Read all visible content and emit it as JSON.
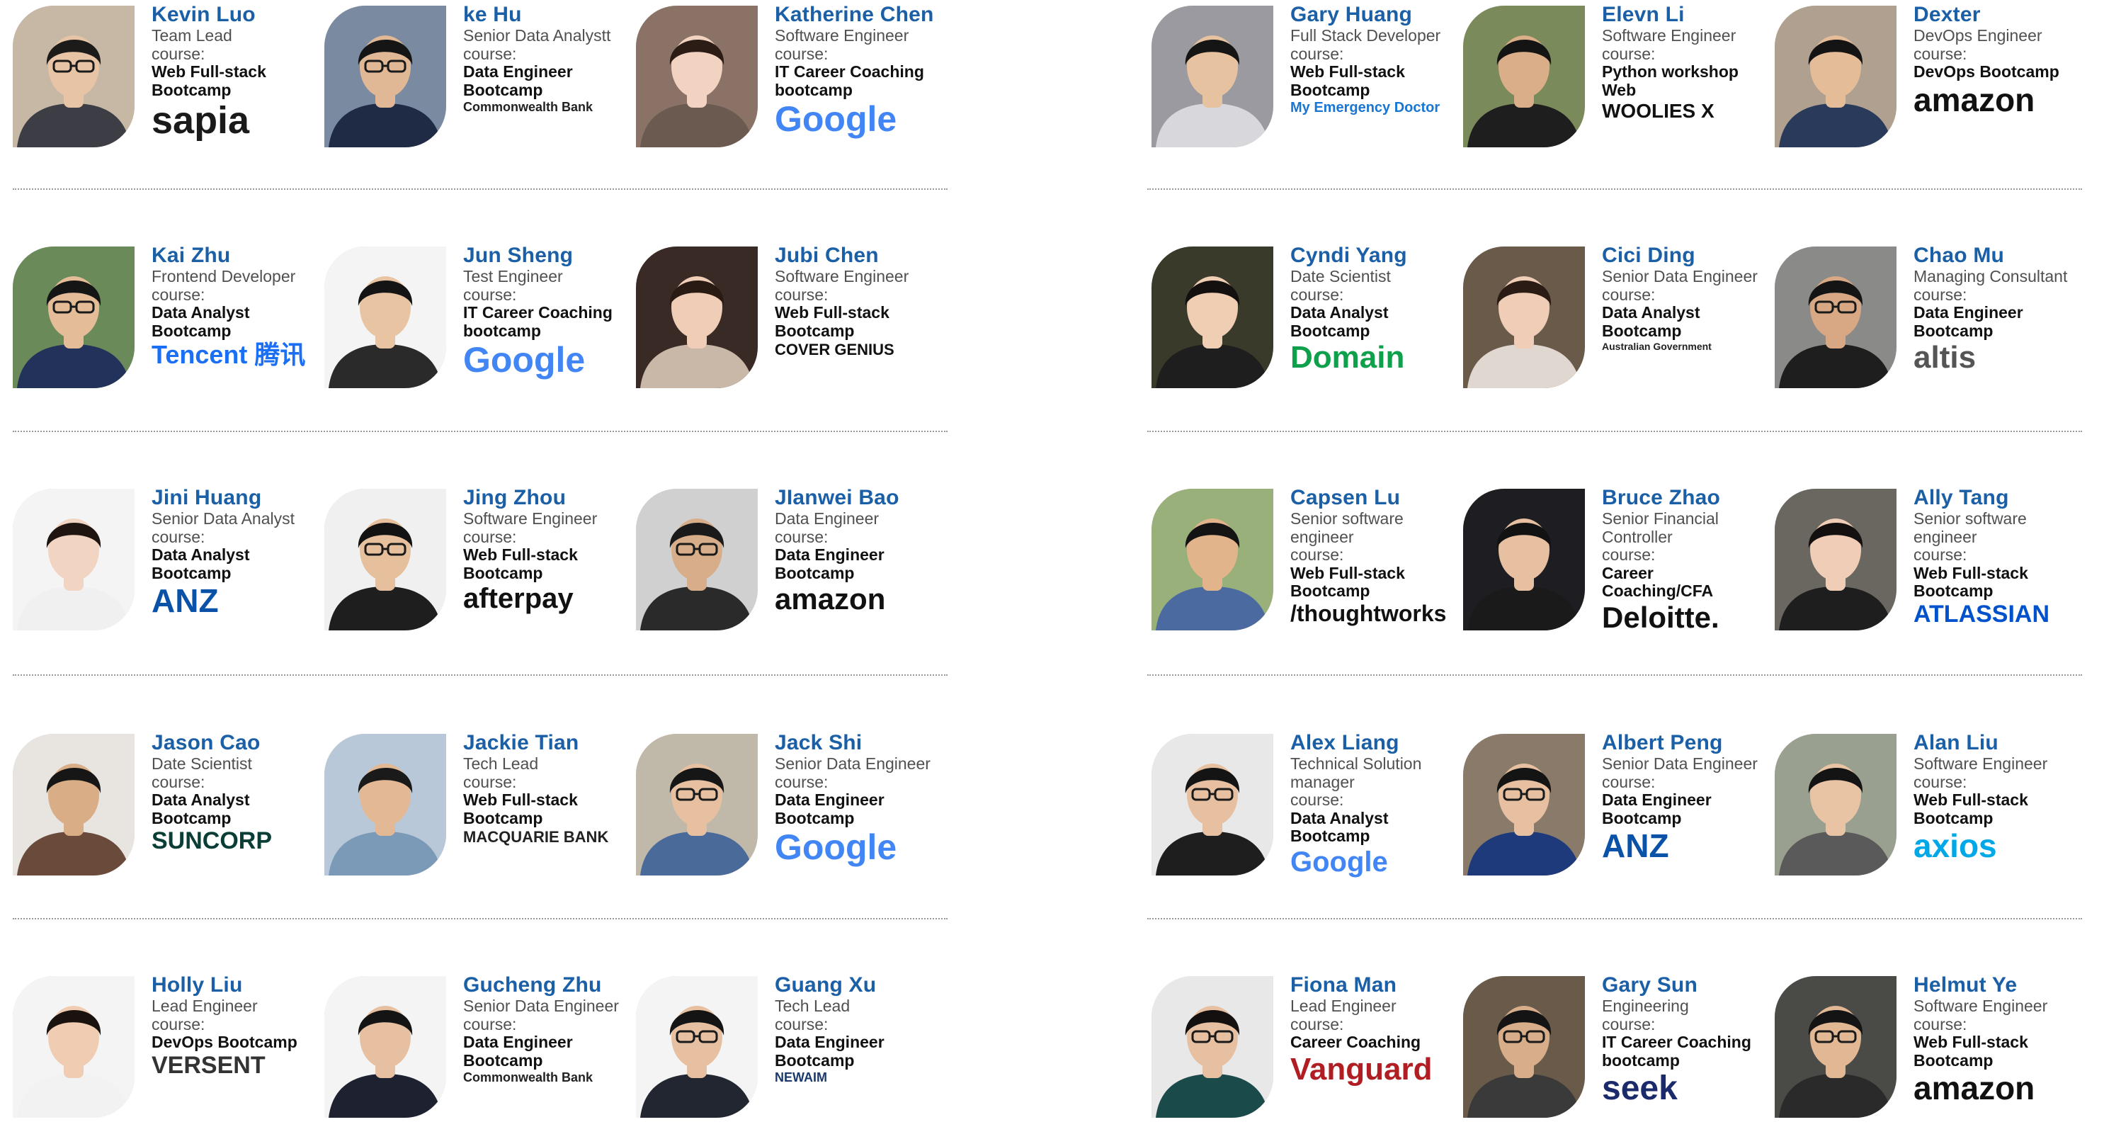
{
  "left_rows": [
    [
      {
        "name": "Kevin Luo",
        "title": "Team Lead",
        "course_label": "course:",
        "course": "Web Full-stack Bootcamp",
        "company": "sapia",
        "color": "#1a1a1a",
        "size": 54,
        "skin": "#e8c4a6",
        "shirt": "#3d3d45",
        "bg": "#c7b8a6",
        "hair": "#1d1b1a",
        "glasses": true
      },
      {
        "name": "ke Hu",
        "title": "Senior Data Analystt",
        "course_label": "course:",
        "course": "Data Engineer Bootcamp",
        "company": "Commonwealth Bank",
        "color": "#222",
        "size": 18,
        "skin": "#e0b896",
        "shirt": "#1f2a45",
        "bg": "#7a8aa0",
        "hair": "#151515",
        "glasses": true
      },
      {
        "name": "Katherine Chen",
        "title": "Software Engineer",
        "course_label": "course:",
        "course": "IT Career Coaching bootcamp",
        "company": "Google",
        "color": "#4285f4",
        "size": 50,
        "skin": "#f2d2c0",
        "shirt": "#6b5a50",
        "bg": "#8a7266",
        "hair": "#2b1c15",
        "glasses": false
      }
    ],
    [
      {
        "name": "Kai Zhu",
        "title": "Frontend Developer",
        "course_label": "course:",
        "course": "Data Analyst Bootcamp",
        "company": "Tencent 腾讯",
        "color": "#1b6ff5",
        "size": 36,
        "skin": "#e4bd98",
        "shirt": "#23325a",
        "bg": "#6a8a5a",
        "hair": "#151515",
        "glasses": true
      },
      {
        "name": "Jun Sheng",
        "title": "Test Engineer",
        "course_label": "course:",
        "course": "IT Career Coaching bootcamp",
        "company": "Google",
        "color": "#4285f4",
        "size": 50,
        "skin": "#e8c4a2",
        "shirt": "#2a2a2a",
        "bg": "#f4f4f4",
        "hair": "#141414",
        "glasses": false
      },
      {
        "name": "Jubi Chen",
        "title": "Software Engineer",
        "course_label": "course:",
        "course": "Web Full-stack Bootcamp",
        "company": "COVER GENIUS",
        "color": "#111",
        "size": 22,
        "skin": "#f0cdb6",
        "shirt": "#c9b7a8",
        "bg": "#3a2a26",
        "hair": "#2a1a14",
        "glasses": false
      }
    ],
    [
      {
        "name": "Jini Huang",
        "title": "Senior Data Analyst",
        "course_label": "course:",
        "course": "Data Analyst Bootcamp",
        "company": "ANZ",
        "color": "#0a52a8",
        "size": 46,
        "skin": "#f2d4c2",
        "shirt": "#f0f0f0",
        "bg": "#f4f4f4",
        "hair": "#1e1410",
        "glasses": false
      },
      {
        "name": "Jing Zhou",
        "title": "Software Engineer",
        "course_label": "course:",
        "course": "Web Full-stack Bootcamp",
        "company": "afterpay",
        "color": "#111",
        "size": 40,
        "skin": "#e6bf9c",
        "shirt": "#1e1e1e",
        "bg": "#f0f0f0",
        "hair": "#121212",
        "glasses": true
      },
      {
        "name": "JIanwei Bao",
        "title": "Data Engineer",
        "course_label": "course:",
        "course": "Data Engineer Bootcamp",
        "company": "amazon",
        "color": "#111",
        "size": 42,
        "skin": "#d8ae8a",
        "shirt": "#2a2a2a",
        "bg": "#d0d0d0",
        "hair": "#1a1a1a",
        "glasses": true
      }
    ],
    [
      {
        "name": "Jason Cao",
        "title": "Date Scientist",
        "course_label": "course:",
        "course": "Data Analyst Bootcamp",
        "company": "SUNCORP",
        "color": "#0a3d35",
        "size": 34,
        "skin": "#d9ad86",
        "shirt": "#6a4a3a",
        "bg": "#e8e4e0",
        "hair": "#161616",
        "glasses": false
      },
      {
        "name": "Jackie Tian",
        "title": "Tech Lead",
        "course_label": "course:",
        "course": "Web Full-stack Bootcamp",
        "company": "MACQUARIE BANK",
        "color": "#222",
        "size": 22,
        "skin": "#e2b994",
        "shirt": "#7a9ab8",
        "bg": "#b8c8d8",
        "hair": "#1a1a1a",
        "glasses": false
      },
      {
        "name": "Jack Shi",
        "title": "Senior Data Engineer",
        "course_label": "course:",
        "course": "Data Engineer Bootcamp",
        "company": "Google",
        "color": "#4285f4",
        "size": 50,
        "skin": "#e6c0a0",
        "shirt": "#4a6a9a",
        "bg": "#c0b8a8",
        "hair": "#161616",
        "glasses": true
      }
    ],
    [
      {
        "name": "Holly Liu",
        "title": "Lead Engineer",
        "course_label": "course:",
        "course": "DevOps Bootcamp",
        "company": "VERSENT",
        "color": "#333",
        "size": 34,
        "skin": "#f0ccb2",
        "shirt": "#f2f2f2",
        "bg": "#f4f4f4",
        "hair": "#1a120e",
        "glasses": false
      },
      {
        "name": "Gucheng Zhu",
        "title": "Senior Data Engineer",
        "course_label": "course:",
        "course": "Data Engineer Bootcamp",
        "company": "Commonwealth Bank",
        "color": "#222",
        "size": 18,
        "skin": "#e6c0a0",
        "shirt": "#1e2230",
        "bg": "#f4f4f4",
        "hair": "#141414",
        "glasses": false
      },
      {
        "name": "Guang Xu",
        "title": "Tech Lead",
        "course_label": "course:",
        "course": "Data Engineer Bootcamp",
        "company": "NEWAIM",
        "color": "#1b3a6b",
        "size": 18,
        "skin": "#e6c0a0",
        "shirt": "#222630",
        "bg": "#f4f4f4",
        "hair": "#141414",
        "glasses": true
      }
    ]
  ],
  "right_rows": [
    [
      {
        "name": "Gary Huang",
        "title": "Full Stack Developer",
        "course_label": "course:",
        "course": "Web Full-stack Bootcamp",
        "company": "My Emergency Doctor",
        "color": "#1976d2",
        "size": 20,
        "skin": "#e6c2a0",
        "shirt": "#d8d8dc",
        "bg": "#9a9aa0",
        "hair": "#151515",
        "glasses": false
      },
      {
        "name": "Elevn Li",
        "title": "Software Engineer",
        "course_label": "course:",
        "course": "Python workshop Web",
        "company": "WOOLIES X",
        "color": "#111",
        "size": 28,
        "skin": "#d9ae88",
        "shirt": "#1e1e1e",
        "bg": "#7a8a5a",
        "hair": "#141414",
        "glasses": false
      },
      {
        "name": "Dexter",
        "title": "DevOps Engineer",
        "course_label": "course:",
        "course": "DevOps Bootcamp",
        "company": "amazon",
        "color": "#111",
        "size": 46,
        "skin": "#e4bc98",
        "shirt": "#2a3a5a",
        "bg": "#b0a090",
        "hair": "#141414",
        "glasses": false
      }
    ],
    [
      {
        "name": "Cyndi Yang",
        "title": "Date Scientist",
        "course_label": "course:",
        "course": "Data Analyst Bootcamp",
        "company": "Domain",
        "color": "#0ea04a",
        "size": 44,
        "skin": "#f0ceb4",
        "shirt": "#1e1e1e",
        "bg": "#3a3a2a",
        "hair": "#141010",
        "glasses": false
      },
      {
        "name": "Cici Ding",
        "title": "Senior Data Engineer",
        "course_label": "course:",
        "course": "Data Analyst Bootcamp",
        "company": "Australian Government",
        "color": "#222",
        "size": 14,
        "skin": "#f0cdb6",
        "shirt": "#e0d8d0",
        "bg": "#6a5a4a",
        "hair": "#2a1c14",
        "glasses": false
      },
      {
        "name": "Chao Mu",
        "title": "Managing Consultant",
        "course_label": "course:",
        "course": "Data Engineer Bootcamp",
        "company": "altis",
        "color": "#555",
        "size": 44,
        "skin": "#d8a884",
        "shirt": "#1e1e1e",
        "bg": "#8a8a88",
        "hair": "#141414",
        "glasses": true
      }
    ],
    [
      {
        "name": "Capsen Lu",
        "title": "Senior software engineer",
        "course_label": "course:",
        "course": "Web Full-stack Bootcamp",
        "company": "/thoughtworks",
        "color": "#111",
        "size": 32,
        "skin": "#e2b48c",
        "shirt": "#4a6aa0",
        "bg": "#9ab07a",
        "hair": "#141414",
        "glasses": false
      },
      {
        "name": "Bruce Zhao",
        "title": "Senior Financial Controller",
        "course_label": "course:",
        "course": "Career Coaching/CFA",
        "company": "Deloitte.",
        "color": "#111",
        "size": 42,
        "skin": "#e6c0a0",
        "shirt": "#1a1a1a",
        "bg": "#1e1e22",
        "hair": "#121212",
        "glasses": false
      },
      {
        "name": "Ally Tang",
        "title": "Senior software engineer",
        "course_label": "course:",
        "course": "Web Full-stack Bootcamp",
        "company": "ATLASSIAN",
        "color": "#0052cc",
        "size": 34,
        "skin": "#f0cdb6",
        "shirt": "#1e1e1e",
        "bg": "#6a6660",
        "hair": "#141010",
        "glasses": false
      }
    ],
    [
      {
        "name": "Alex Liang",
        "title": "Technical Solution manager",
        "course_label": "course:",
        "course": "Data Analyst Bootcamp",
        "company": "Google",
        "color": "#4285f4",
        "size": 40,
        "skin": "#e6c0a0",
        "shirt": "#1e1e1e",
        "bg": "#e8e8e8",
        "hair": "#141414",
        "glasses": true
      },
      {
        "name": "Albert Peng",
        "title": "Senior Data Engineer",
        "course_label": "course:",
        "course": "Data Engineer Bootcamp",
        "company": "ANZ",
        "color": "#0a52a8",
        "size": 46,
        "skin": "#e6c0a0",
        "shirt": "#1e3a7a",
        "bg": "#8a7a6a",
        "hair": "#141414",
        "glasses": true
      },
      {
        "name": "Alan Liu",
        "title": "Software Engineer",
        "course_label": "course:",
        "course": "Web Full-stack Bootcamp",
        "company": "axios",
        "color": "#00a8e8",
        "size": 46,
        "skin": "#e8c4a4",
        "shirt": "#5a5a5a",
        "bg": "#9aa090",
        "hair": "#141414",
        "glasses": false
      }
    ],
    [
      {
        "name": "Fiona Man",
        "title": "Lead Engineer",
        "course_label": "course:",
        "course": "Career Coaching",
        "company": "Vanguard",
        "color": "#b01e23",
        "size": 44,
        "skin": "#e6c0a0",
        "shirt": "#1a4a4a",
        "bg": "#e8e8e8",
        "hair": "#141010",
        "glasses": true
      },
      {
        "name": "Gary Sun",
        "title": "Engineering",
        "course_label": "course:",
        "course": "IT Career Coaching bootcamp",
        "company": "seek",
        "color": "#1a2a6a",
        "size": 48,
        "skin": "#d8ae8a",
        "shirt": "#3a3a3a",
        "bg": "#6a5a4a",
        "hair": "#141414",
        "glasses": true
      },
      {
        "name": "Helmut Ye",
        "title": "Software Engineer",
        "course_label": "course:",
        "course": "Web Full-stack Bootcamp",
        "company": "amazon",
        "color": "#111",
        "size": 46,
        "skin": "#e2b894",
        "shirt": "#2a2a2a",
        "bg": "#4a4a46",
        "hair": "#141414",
        "glasses": true
      }
    ]
  ]
}
